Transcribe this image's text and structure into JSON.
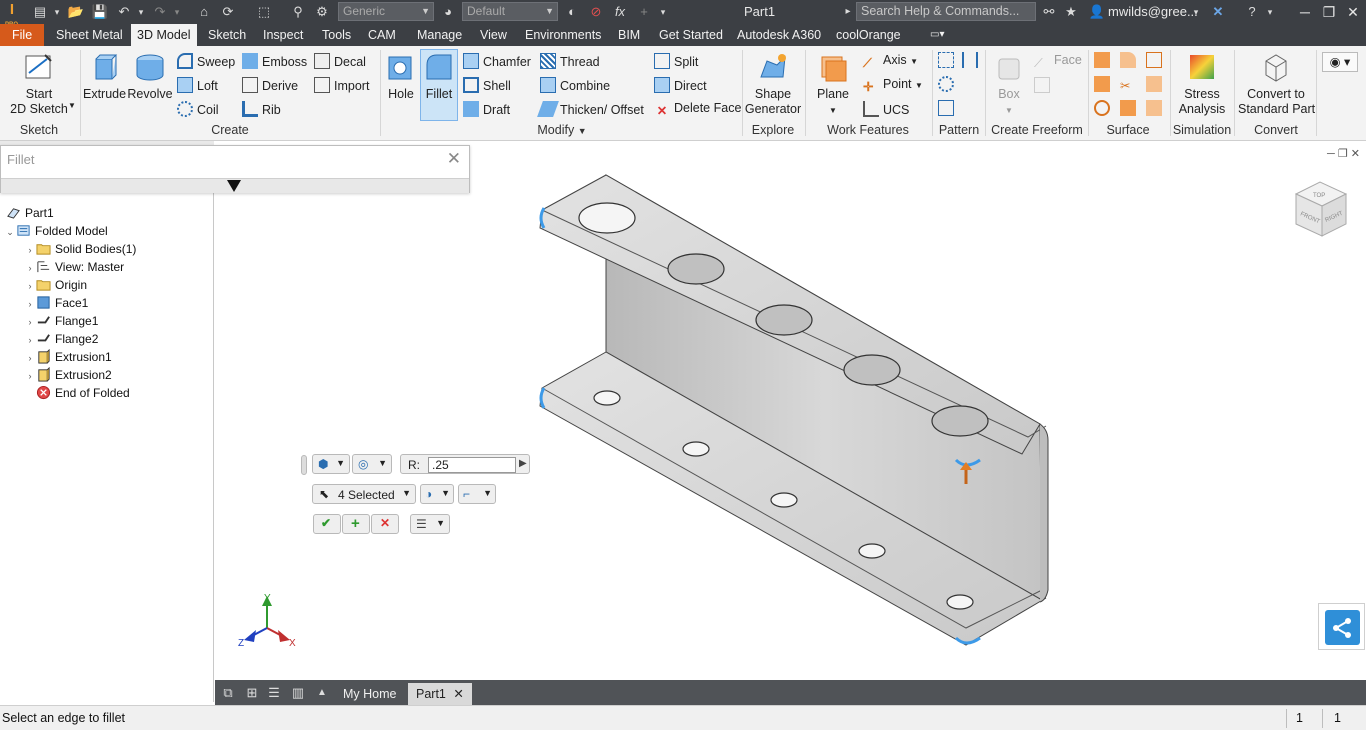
{
  "titlebar": {
    "logo": "I",
    "logo_sub": "PRO",
    "material_combo": "Generic",
    "appearance_combo": "Default",
    "fx_label": "fx",
    "doc_title": "Part1",
    "search_placeholder": "Search Help & Commands...",
    "user": "mwilds@gree..."
  },
  "tabs": [
    "File",
    "Sheet Metal",
    "3D Model",
    "Sketch",
    "Inspect",
    "Tools",
    "Manage",
    "View",
    "Environments",
    "BIM",
    "Get Started",
    "Autodesk A360",
    "coolOrange"
  ],
  "active_tab": "3D Model",
  "ribbon": {
    "sketch": {
      "start_line1": "Start",
      "start_line2": "2D Sketch",
      "group": "Sketch"
    },
    "create": {
      "extrude": "Extrude",
      "revolve": "Revolve",
      "sweep": "Sweep",
      "loft": "Loft",
      "coil": "Coil",
      "emboss": "Emboss",
      "derive": "Derive",
      "rib": "Rib",
      "decal": "Decal",
      "import": "Import",
      "group": "Create"
    },
    "modify": {
      "hole": "Hole",
      "fillet": "Fillet",
      "chamfer": "Chamfer",
      "shell": "Shell",
      "draft": "Draft",
      "thread": "Thread",
      "combine": "Combine",
      "thicken": "Thicken/ Offset",
      "split": "Split",
      "direct": "Direct",
      "delete_face": "Delete Face",
      "group": "Modify"
    },
    "explore": {
      "shape_line1": "Shape",
      "shape_line2": "Generator",
      "group": "Explore"
    },
    "work_features": {
      "plane": "Plane",
      "axis": "Axis",
      "point": "Point",
      "ucs": "UCS",
      "group": "Work Features"
    },
    "pattern": {
      "group": "Pattern"
    },
    "freeform": {
      "box": "Box",
      "face": "Face",
      "group": "Create Freeform"
    },
    "surface": {
      "group": "Surface"
    },
    "simulation": {
      "stress_line1": "Stress",
      "stress_line2": "Analysis",
      "group": "Simulation"
    },
    "convert": {
      "line1": "Convert to",
      "line2": "Standard Part",
      "group": "Convert"
    }
  },
  "command_search": {
    "value": "Fillet"
  },
  "browser": {
    "root": "Part1",
    "items": [
      {
        "label": "Folded Model",
        "level": 0,
        "expanded": true
      },
      {
        "label": "Solid Bodies(1)",
        "level": 1
      },
      {
        "label": "View: Master",
        "level": 1
      },
      {
        "label": "Origin",
        "level": 1
      },
      {
        "label": "Face1",
        "level": 1
      },
      {
        "label": "Flange1",
        "level": 1
      },
      {
        "label": "Flange2",
        "level": 1
      },
      {
        "label": "Extrusion1",
        "level": 1
      },
      {
        "label": "Extrusion2",
        "level": 1
      },
      {
        "label": "End of Folded",
        "level": 1
      }
    ]
  },
  "mini_toolbar": {
    "r_label": "R:",
    "r_value": ".25",
    "selected": "4 Selected"
  },
  "viewcube": {
    "top": "TOP",
    "front": "FRONT",
    "right": "RIGHT"
  },
  "triad": {
    "x": "X",
    "y": "Y",
    "z": "Z"
  },
  "doc_tabs": {
    "home": "My Home",
    "part": "Part1"
  },
  "status": {
    "message": "Select an edge to fillet",
    "count1": "1",
    "count2": "1"
  },
  "colors": {
    "file_tab": "#d65a1b",
    "title_bar": "#3c3f44",
    "selection_highlight": "#3d9ae8"
  }
}
